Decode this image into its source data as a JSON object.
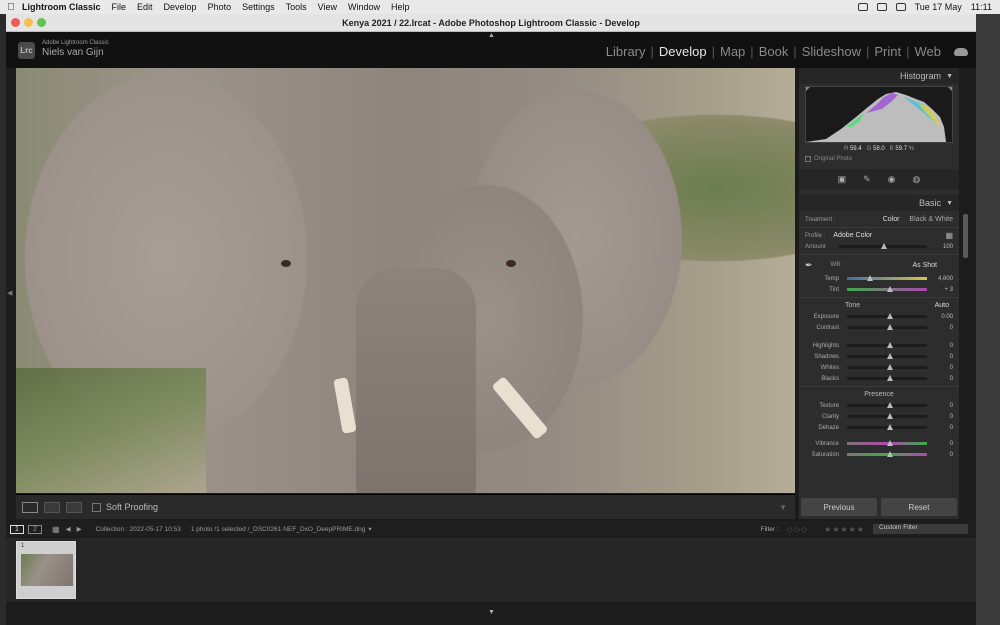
{
  "menubar": {
    "app": "Lightroom Classic",
    "items": [
      "File",
      "Edit",
      "Develop",
      "Photo",
      "Settings",
      "Tools",
      "View",
      "Window",
      "Help"
    ],
    "date": "Tue 17 May",
    "time": "11:11"
  },
  "window": {
    "title": "Kenya 2021 / 22.lrcat - Adobe Photoshop Lightroom Classic - Develop"
  },
  "header": {
    "logo": "Lrc",
    "product": "Adobe Lightroom Classic",
    "user": "Niels van Gijn",
    "modules": [
      "Library",
      "Develop",
      "Map",
      "Book",
      "Slideshow",
      "Print",
      "Web"
    ],
    "active_module": "Develop"
  },
  "toolbar": {
    "soft_proofing": "Soft Proofing"
  },
  "histogram": {
    "label": "Histogram",
    "r_label": "R",
    "r": "59.4",
    "g_label": "G",
    "g": "58.0",
    "b_label": "B",
    "b": "59.7",
    "pct": "%",
    "original_photo": "Original Photo"
  },
  "basic": {
    "label": "Basic",
    "treatment_label": "Treatment :",
    "treatment_color": "Color",
    "treatment_bw": "Black & White",
    "profile_label": "Profile :",
    "profile_value": "Adobe Color",
    "amount_label": "Amount",
    "amount_value": "100",
    "wb_label": "WB :",
    "wb_value": "As Shot",
    "temp_label": "Temp",
    "temp_value": "4,600",
    "tint_label": "Tint",
    "tint_value": "+ 3",
    "tone_label": "Tone",
    "auto_label": "Auto",
    "exposure_label": "Exposure",
    "exposure_value": "0.00",
    "contrast_label": "Contrast",
    "contrast_value": "0",
    "highlights_label": "Highlights",
    "highlights_value": "0",
    "shadows_label": "Shadows",
    "shadows_value": "0",
    "whites_label": "Whites",
    "whites_value": "0",
    "blacks_label": "Blacks",
    "blacks_value": "0",
    "presence_label": "Presence",
    "texture_label": "Texture",
    "texture_value": "0",
    "clarity_label": "Clarity",
    "clarity_value": "0",
    "dehaze_label": "Dehaze",
    "dehaze_value": "0",
    "vibrance_label": "Vibrance",
    "vibrance_value": "0",
    "saturation_label": "Saturation",
    "saturation_value": "0"
  },
  "buttons": {
    "previous": "Previous",
    "reset": "Reset"
  },
  "filmstrip": {
    "page1": "1",
    "page2": "2",
    "collection": "Collection : 2022-05-17 10:53",
    "selection": "1 photo /1 selected /_DSC0261-NEF_DxO_DeepPRIME.dng",
    "filter_label": "Filter :",
    "custom_filter": "Custom Filter",
    "thumb_number": "1"
  },
  "colors": {
    "active_module": "#e6e6e6",
    "panel_bg": "#2d2d2d"
  }
}
